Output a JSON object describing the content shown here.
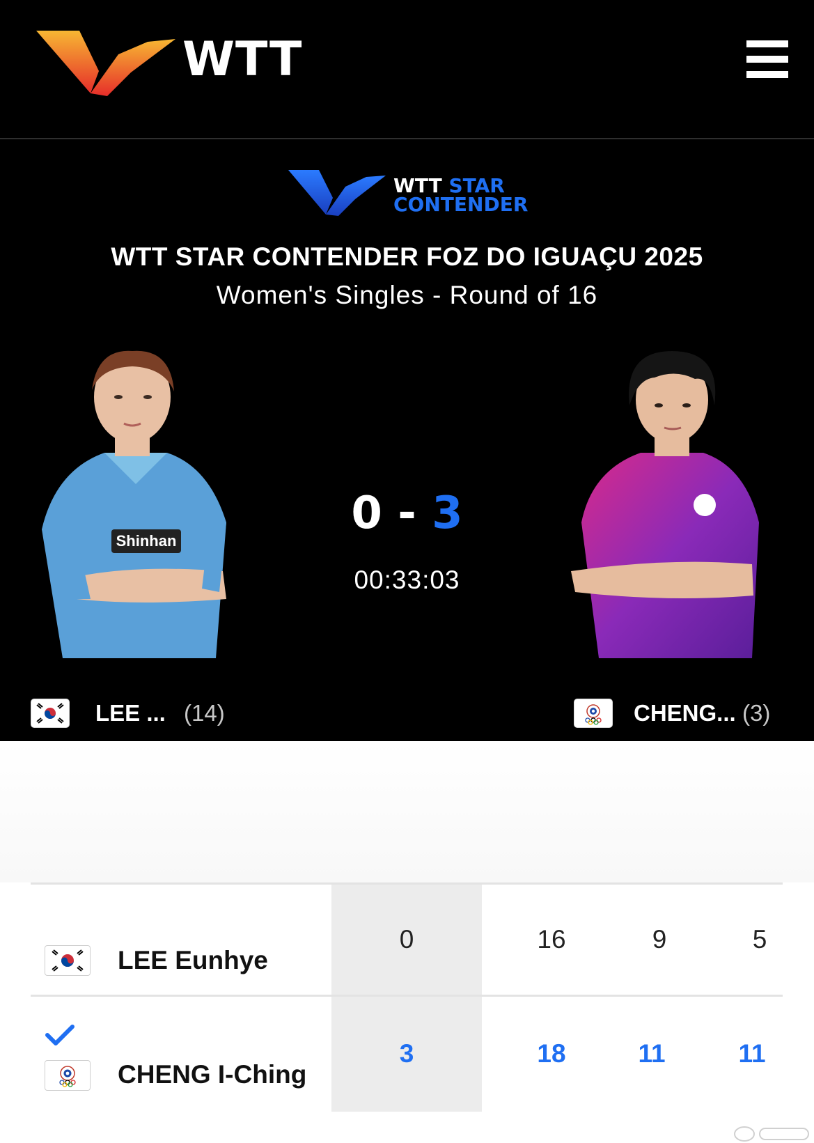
{
  "header": {
    "logo_text": "WTT",
    "menu_icon": "hamburger-menu-icon"
  },
  "event": {
    "logo_line1_a": "WTT",
    "logo_line1_b": "STAR",
    "logo_line2": "CONTENDER",
    "title": "WTT STAR CONTENDER FOZ DO IGUAÇU 2025",
    "subtitle": "Women's Singles - Round of 16"
  },
  "match": {
    "score_p1": "0",
    "score_sep": "-",
    "score_p2": "3",
    "elapsed": "00:33:03"
  },
  "players": [
    {
      "short_name": "LEE ...",
      "seed": "(14)",
      "full_name": "LEE Eunhye",
      "flag": "korea-flag-icon",
      "winner": false,
      "games": "0",
      "sets": [
        "16",
        "9",
        "5"
      ]
    },
    {
      "short_name": "CHENG...",
      "seed": "(3)",
      "full_name": "CHENG I-Ching",
      "flag": "chinese-taipei-flag-icon",
      "winner": true,
      "games": "3",
      "sets": [
        "18",
        "11",
        "11"
      ]
    }
  ],
  "colors": {
    "accent_blue": "#1f6ff2",
    "header_bg": "#000000",
    "logo_orange": "#f5a623",
    "logo_red": "#e8322a"
  }
}
